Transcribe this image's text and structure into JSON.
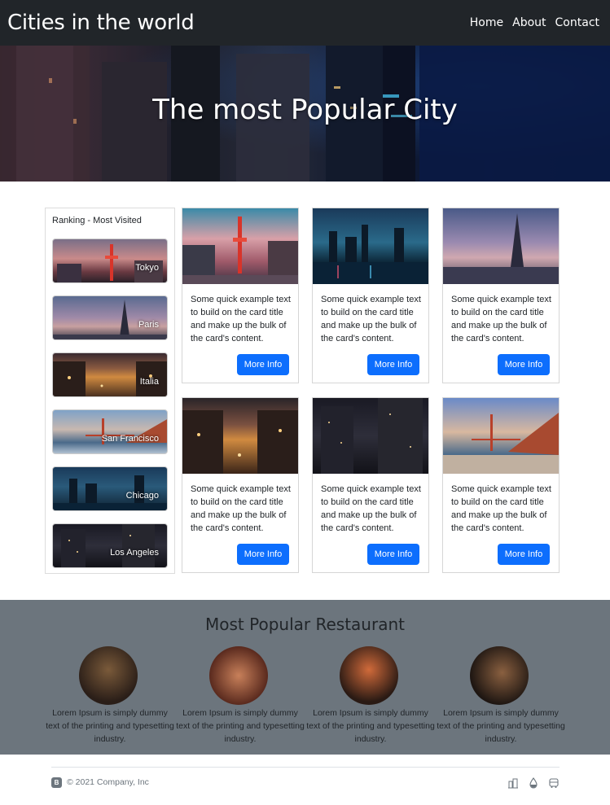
{
  "navbar": {
    "brand": "Cities in the world",
    "links": [
      "Home",
      "About",
      "Contact"
    ]
  },
  "hero": {
    "title": "The most Popular City"
  },
  "sidebar": {
    "title": "Ranking - Most Visited",
    "items": [
      "Tokyo",
      "Paris",
      "Italia",
      "San Francisco",
      "Chicago",
      "Los Angeles"
    ]
  },
  "cards": [
    {
      "text": "Some quick example text to build on the card title and make up the bulk of the card's content.",
      "button": "More Info"
    },
    {
      "text": "Some quick example text to build on the card title and make up the bulk of the card's content.",
      "button": "More Info"
    },
    {
      "text": "Some quick example text to build on the card title and make up the bulk of the card's content.",
      "button": "More Info"
    },
    {
      "text": "Some quick example text to build on the card title and make up the bulk of the card's content.",
      "button": "More Info"
    },
    {
      "text": "Some quick example text to build on the card title and make up the bulk of the card's content.",
      "button": "More Info"
    },
    {
      "text": "Some quick example text to build on the card title and make up the bulk of the card's content.",
      "button": "More Info"
    }
  ],
  "restaurants": {
    "title": "Most Popular Restaurant",
    "items": [
      "Lorem Ipsum is simply dummy text of the printing and typesetting industry.",
      "Lorem Ipsum is simply dummy text of the printing and typesetting industry.",
      "Lorem Ipsum is simply dummy text of the printing and typesetting industry.",
      "Lorem Ipsum is simply dummy text of the printing and typesetting industry."
    ]
  },
  "footer": {
    "logo": "B",
    "copyright": "© 2021 Company, Inc",
    "icons": [
      "building-icon",
      "droplet-icon",
      "bus-icon"
    ]
  },
  "colors": {
    "navbar": "#212529",
    "primary_button": "#0d6efd",
    "restaurant_section": "#6c757d"
  }
}
